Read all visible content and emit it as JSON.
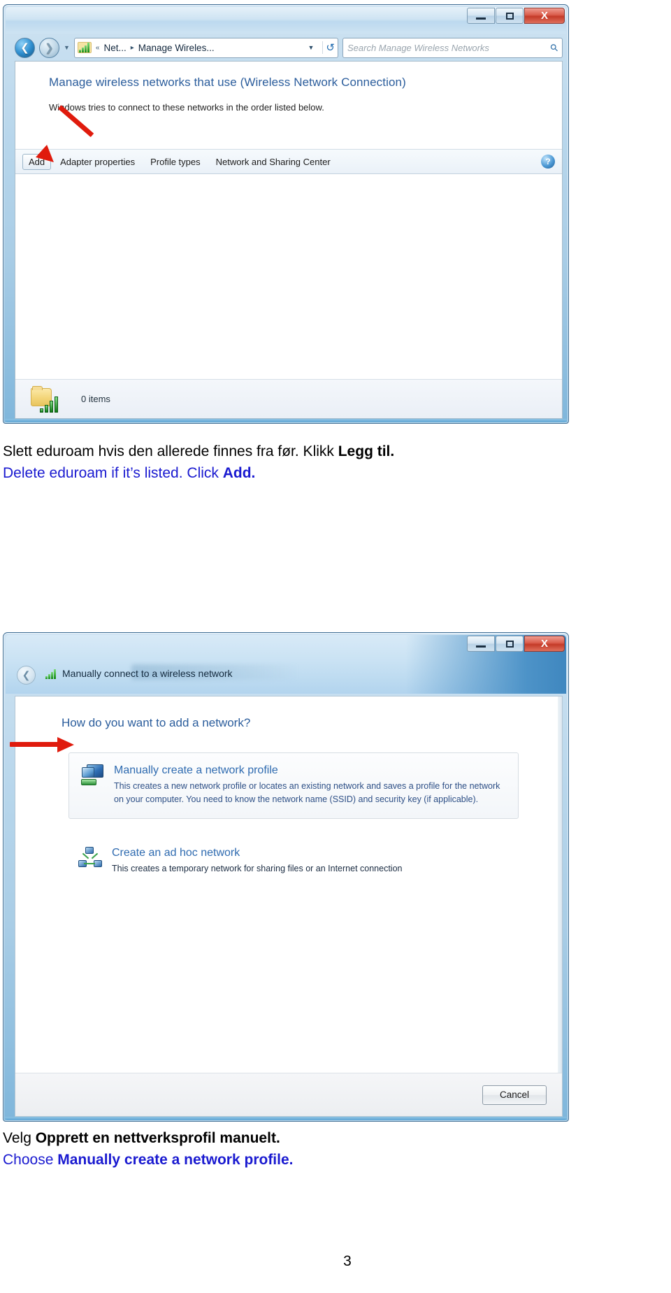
{
  "window1": {
    "name": "Manage Wireless Networks",
    "controls": {
      "minimize": "–",
      "maximize": "□",
      "close": "X"
    },
    "nav": {
      "back_icon": "back-arrow",
      "forward_icon": "forward-arrow",
      "history_icon": "chevron-down"
    },
    "breadcrumb": {
      "icon": "wireless-signal-icon",
      "overflow": "«",
      "items": [
        "Net...",
        "Manage Wireles..."
      ],
      "separator": "▸",
      "caret": "▼",
      "refresh_icon": "↺"
    },
    "search": {
      "placeholder": "Search Manage Wireless Networks",
      "icon": "search-icon"
    },
    "heading": "Manage wireless networks that use (Wireless Network Connection)",
    "subheading": "Windows tries to connect to these networks in the order listed below.",
    "toolbar": {
      "buttons": [
        "Add",
        "Adapter properties",
        "Profile types",
        "Network and Sharing Center"
      ],
      "help_label": "?"
    },
    "status": {
      "icon": "folder-wireless-icon",
      "text": "0 items"
    }
  },
  "caption1": {
    "line_no_pre": "Slett eduroam hvis den allerede finnes fra før.  Klikk ",
    "line_no_bold": "Legg til.",
    "line_en_pre": "Delete eduroam if it’s listed. Click  ",
    "line_en_bold": "Add."
  },
  "window2": {
    "title": "Manually connect to a wireless network",
    "title_icon": "wireless-signal-icon",
    "back_icon": "back-arrow",
    "controls": {
      "minimize": "–",
      "maximize": "□",
      "close": "X"
    },
    "question": "How do you want to add a network?",
    "options": [
      {
        "title": "Manually create a network profile",
        "icon": "network-profile-icon",
        "description": "This creates a new network profile or locates an existing network and saves a profile for the network on your computer. You need to know the network name (SSID) and security key (if applicable)."
      },
      {
        "title": "Create an ad hoc network",
        "icon": "ad-hoc-network-icon",
        "description": "This creates a temporary network for sharing files or an Internet connection"
      }
    ],
    "cancel_label": "Cancel"
  },
  "caption2": {
    "line_no_pre": "Velg ",
    "line_no_bold": "Opprett en nettverksprofil manuelt.",
    "line_en_pre": "Choose ",
    "line_en_bold": "Manually create a network profile."
  },
  "page_number": "3",
  "colors": {
    "accent_blue": "#2b5d9c",
    "caption_blue": "#1a1ad0",
    "arrow_red": "#e01b0d",
    "close_red": "#c33a28"
  }
}
